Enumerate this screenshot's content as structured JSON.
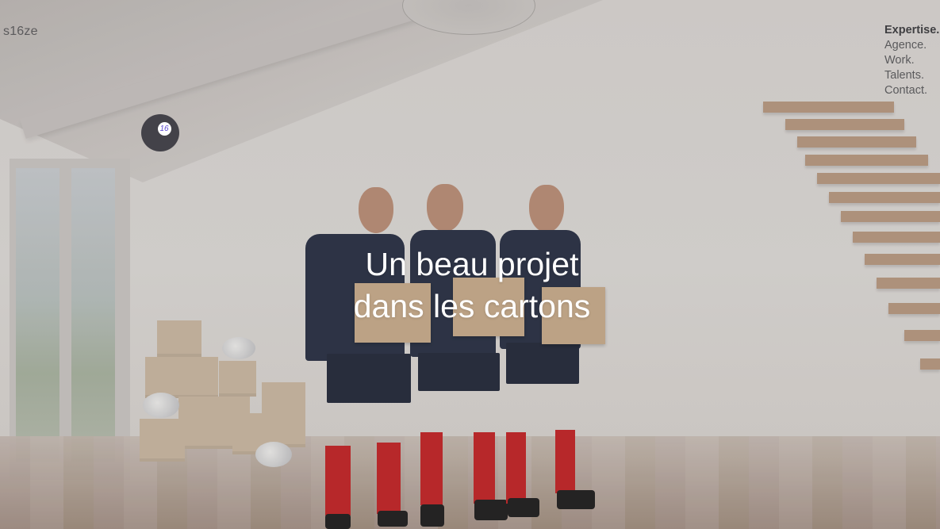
{
  "brand": {
    "logo_text": "s16ze"
  },
  "nav": {
    "items": [
      {
        "label": "Expertise.",
        "active": true
      },
      {
        "label": "Agence.",
        "active": false
      },
      {
        "label": "Work.",
        "active": false
      },
      {
        "label": "Talents.",
        "active": false
      },
      {
        "label": "Contact.",
        "active": false
      }
    ]
  },
  "badge": {
    "text": "16"
  },
  "hero": {
    "headline_line1": "Un beau projet",
    "headline_line2": "dans les cartons"
  },
  "colors": {
    "text": "#5a5a5c",
    "headline": "#ffffff",
    "badge_bg": "#434249",
    "badge_accent": "#5c4ad0",
    "socks": "#c2282a"
  }
}
